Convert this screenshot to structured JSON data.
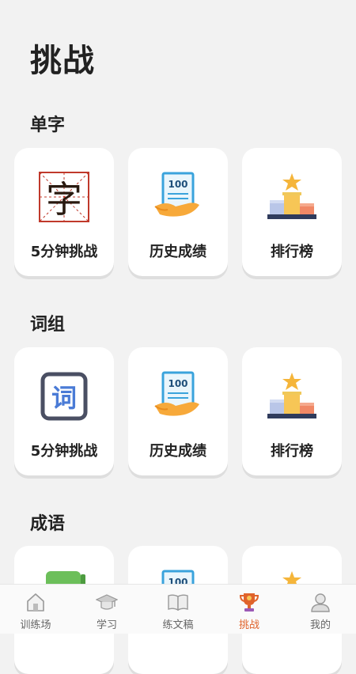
{
  "page": {
    "title": "挑战"
  },
  "sections": [
    {
      "title": "单字",
      "main_icon_glyph": "字",
      "cards": [
        {
          "label": "5分钟挑战"
        },
        {
          "label": "历史成绩"
        },
        {
          "label": "排行榜"
        }
      ]
    },
    {
      "title": "词组",
      "main_icon_glyph": "词",
      "cards": [
        {
          "label": "5分钟挑战"
        },
        {
          "label": "历史成绩"
        },
        {
          "label": "排行榜"
        }
      ]
    },
    {
      "title": "成语"
    }
  ],
  "score_icon_text": "100",
  "tabbar": {
    "items": [
      {
        "label": "训练场",
        "icon": "house-icon"
      },
      {
        "label": "学习",
        "icon": "graduation-cap-icon"
      },
      {
        "label": "练文稿",
        "icon": "open-book-icon"
      },
      {
        "label": "挑战",
        "icon": "trophy-icon",
        "active": true
      },
      {
        "label": "我的",
        "icon": "user-icon"
      }
    ]
  },
  "colors": {
    "accent": "#e0632b",
    "background": "#f2f2f2",
    "card": "#ffffff"
  }
}
